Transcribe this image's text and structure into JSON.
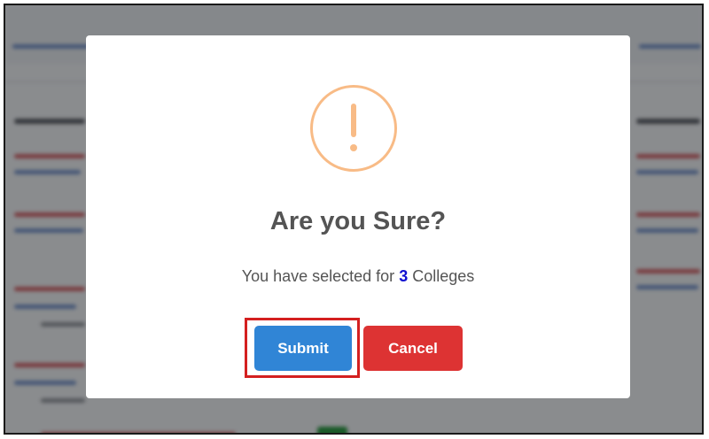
{
  "dialog": {
    "icon": "warning-exclamation-icon",
    "title": "Are you Sure?",
    "message_prefix": "You have selected for",
    "selected_count": "3",
    "message_suffix": "Colleges",
    "submit_label": "Submit",
    "cancel_label": "Cancel"
  },
  "colors": {
    "warning": "#f8bb86",
    "submit": "#3085d6",
    "cancel": "#dd3333",
    "highlight": "#d42020",
    "count": "#1010d0"
  }
}
